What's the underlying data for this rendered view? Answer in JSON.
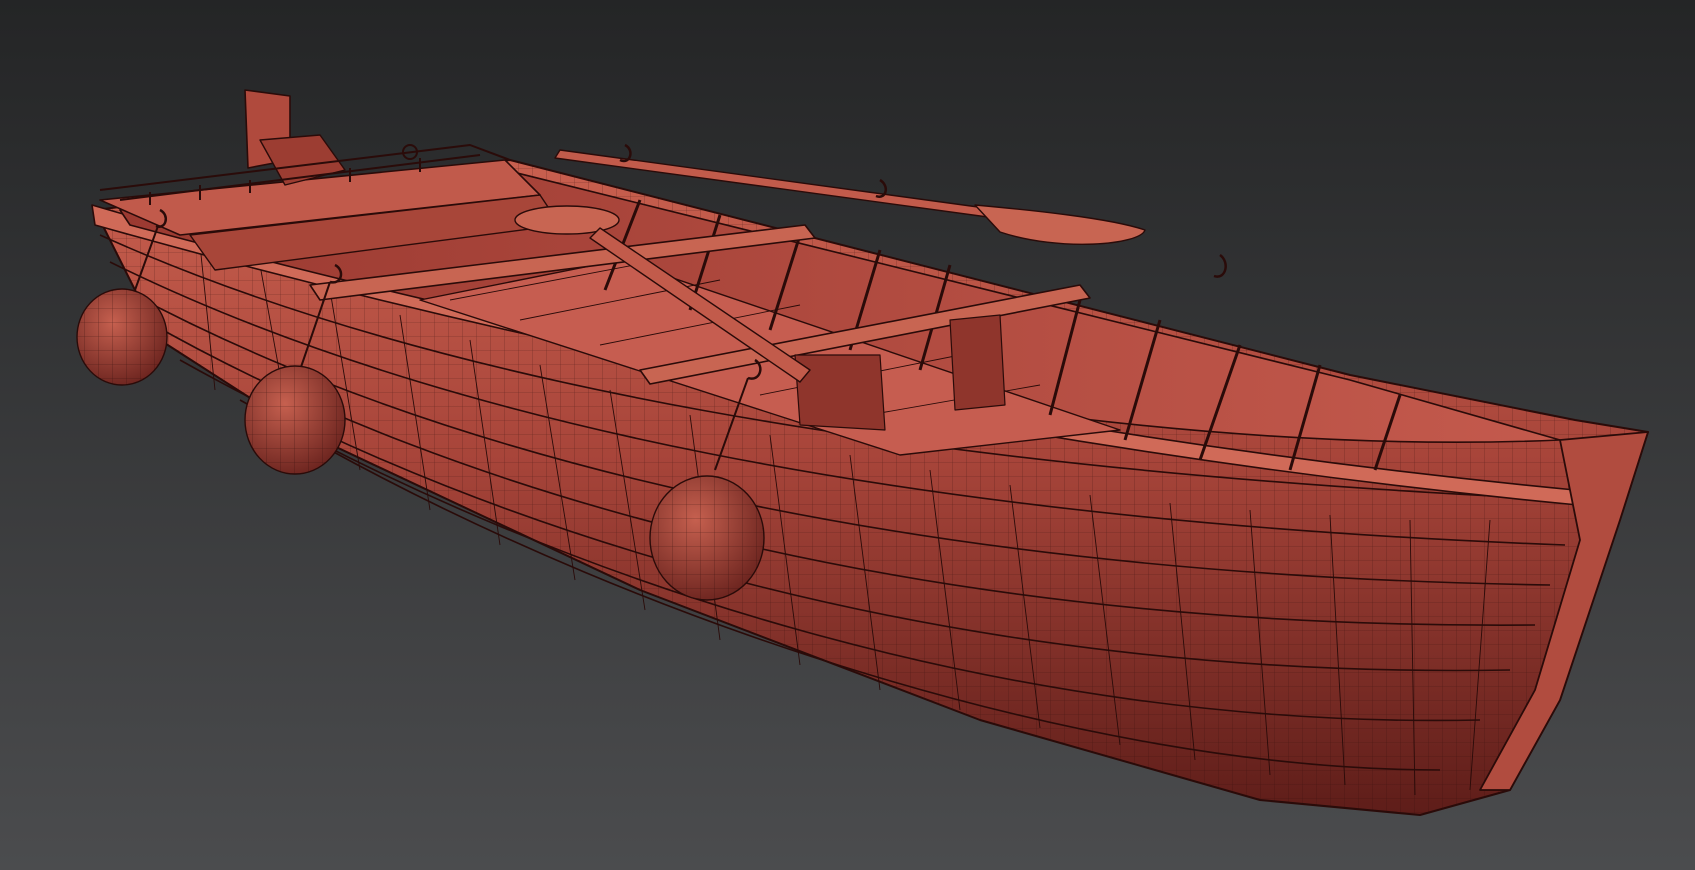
{
  "viewport": {
    "background_top": "#242526",
    "background_bottom": "#4b4c4e"
  },
  "model": {
    "object": "rowboat",
    "display_mode": "shaded-wireframe",
    "colors": {
      "hull_light": "#c0584a",
      "hull_mid": "#a8453a",
      "hull_dark": "#6e2520",
      "interior": "#b44a3e",
      "floor": "#c65d50",
      "wire": "#2a0b09"
    }
  }
}
